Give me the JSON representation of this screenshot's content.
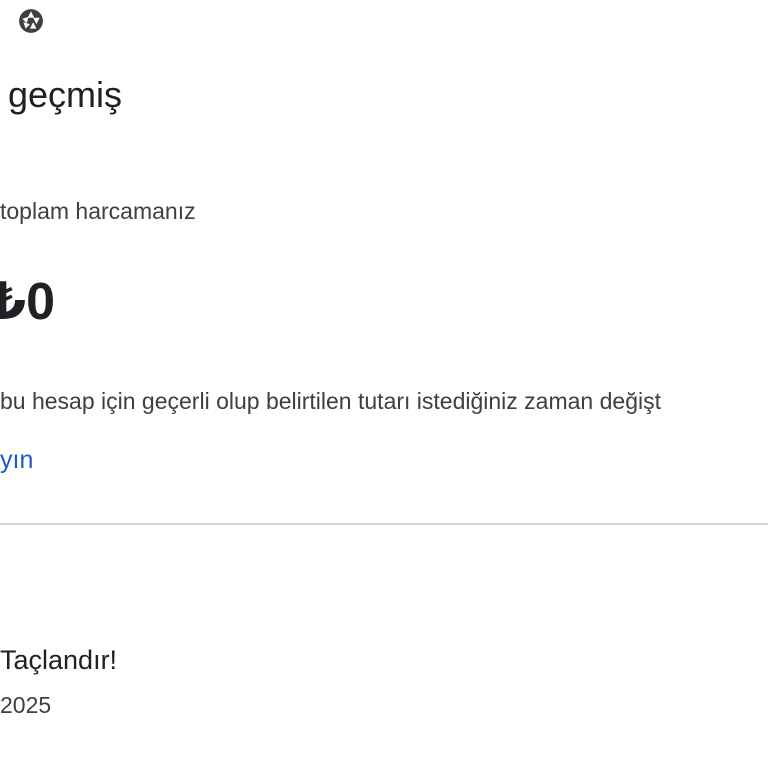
{
  "header": {
    "icon": "aperture-icon",
    "title": "geçmiş"
  },
  "spend": {
    "label": "toplam harcamanız",
    "amount": "₺0"
  },
  "info": {
    "text": "bu hesap için geçerli olup belirtilen tutarı istediğiniz zaman değişt",
    "link": "yın"
  },
  "purchases": [
    {
      "title": "Taçlandır!",
      "date": "2025"
    }
  ],
  "colors": {
    "link": "#1a59c9",
    "divider": "#d3d3d3",
    "text": "#202124"
  }
}
